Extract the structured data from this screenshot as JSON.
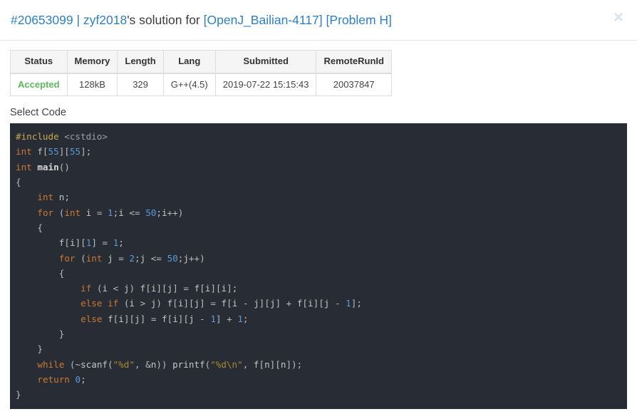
{
  "header": {
    "submission_id": "#20653099",
    "separator": "|",
    "username": "zyf2018",
    "possessive": "'s solution for",
    "problem_source": "[OpenJ_Bailian-4117]",
    "problem_label": "[Problem H]",
    "close_icon": "close-icon",
    "close_glyph": "×",
    "link_color": "#2d7fc1"
  },
  "table": {
    "columns": [
      "Status",
      "Memory",
      "Length",
      "Lang",
      "Submitted",
      "RemoteRunId"
    ],
    "rows": [
      {
        "status": "Accepted",
        "memory": "128kB",
        "length": "329",
        "lang": "G++(4.5)",
        "submitted": "2019-07-22 15:15:43",
        "remote_run_id": "20037847"
      }
    ],
    "status_color": "#5cb85c",
    "header_bg": "#f5f5f5"
  },
  "select_code": {
    "label": "Select Code"
  },
  "code": {
    "language": "cpp",
    "background": "#282c34",
    "lines": [
      "#include <cstdio>",
      "int f[55][55];",
      "int main()",
      "{",
      "    int n;",
      "    for (int i = 1;i <= 50;i++)",
      "    {",
      "        f[i][1] = 1;",
      "        for (int j = 2;j <= 50;j++)",
      "        {",
      "            if (i < j) f[i][j] = f[i][i];",
      "            else if (i > j) f[i][j] = f[i - j][j] + f[i][j - 1];",
      "            else f[i][j] = f[i][j - 1] + 1;",
      "        }",
      "    }",
      "    while (~scanf(\"%d\", &n)) printf(\"%d\\n\", f[n][n]);",
      "    return 0;",
      "}"
    ]
  }
}
